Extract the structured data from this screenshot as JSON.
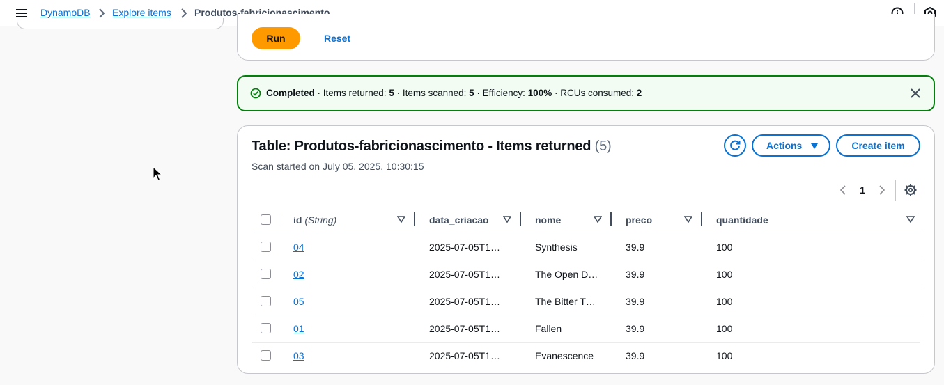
{
  "breadcrumb": {
    "items": [
      "DynamoDB",
      "Explore items"
    ],
    "current": "Produtos-fabricionascimento"
  },
  "icons": {
    "menu": "hamburger-menu-icon",
    "info": "info-circle-icon",
    "settings": "cube-settings-icon"
  },
  "query": {
    "run_label": "Run",
    "reset_label": "Reset"
  },
  "flash": {
    "status": "Completed",
    "items_returned_label": " · Items returned: ",
    "items_returned": "5",
    "items_scanned_label": " · Items scanned: ",
    "items_scanned": "5",
    "efficiency_label": " · Efficiency: ",
    "efficiency": "100%",
    "rcus_label": " · RCUs consumed: ",
    "rcus": "2",
    "status_color": "#037f0c"
  },
  "table": {
    "title": "Table: Produtos-fabricionascimento - Items returned",
    "count": "(5)",
    "scan_started": "Scan started on July 05, 2025, 10:30:15",
    "actions_label": "Actions",
    "create_label": "Create item",
    "page": "1",
    "columns": [
      {
        "name": "id",
        "type": "(String)"
      },
      {
        "name": "data_criacao"
      },
      {
        "name": "nome"
      },
      {
        "name": "preco"
      },
      {
        "name": "quantidade"
      }
    ],
    "rows": [
      {
        "id": "04",
        "data_criacao": "2025-07-05T1…",
        "nome": "Synthesis",
        "preco": "39.9",
        "quantidade": "100"
      },
      {
        "id": "02",
        "data_criacao": "2025-07-05T1…",
        "nome": "The Open D…",
        "preco": "39.9",
        "quantidade": "100"
      },
      {
        "id": "05",
        "data_criacao": "2025-07-05T1…",
        "nome": "The Bitter T…",
        "preco": "39.9",
        "quantidade": "100"
      },
      {
        "id": "01",
        "data_criacao": "2025-07-05T1…",
        "nome": "Fallen",
        "preco": "39.9",
        "quantidade": "100"
      },
      {
        "id": "03",
        "data_criacao": "2025-07-05T1…",
        "nome": "Evanescence",
        "preco": "39.9",
        "quantidade": "100"
      }
    ]
  },
  "colors": {
    "accent": "#0972d3",
    "primary_button": "#ff9900",
    "success": "#037f0c"
  }
}
